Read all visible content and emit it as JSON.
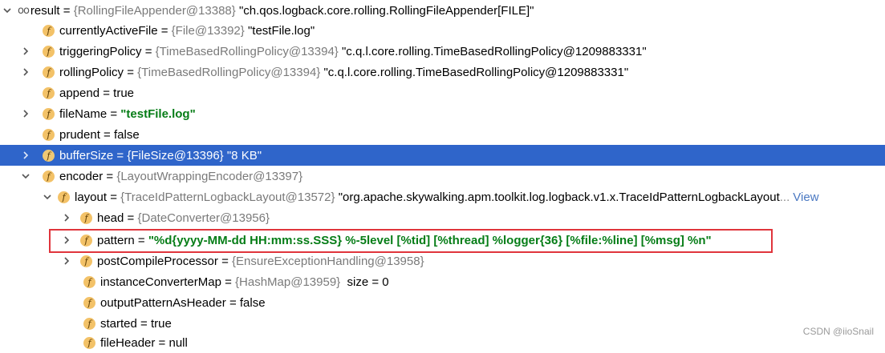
{
  "rows": [
    {
      "expander": "open",
      "name": "result",
      "ref": "{RollingFileAppender@13388}",
      "value": "\"ch.qos.logback.core.rolling.RollingFileAppender[FILE]\""
    },
    {
      "name": "currentlyActiveFile",
      "ref": "{File@13392}",
      "value": "\"testFile.log\""
    },
    {
      "expander": "closed",
      "name": "triggeringPolicy",
      "ref": "{TimeBasedRollingPolicy@13394}",
      "value": "\"c.q.l.core.rolling.TimeBasedRollingPolicy@1209883331\""
    },
    {
      "expander": "closed",
      "name": "rollingPolicy",
      "ref": "{TimeBasedRollingPolicy@13394}",
      "value": "\"c.q.l.core.rolling.TimeBasedRollingPolicy@1209883331\""
    },
    {
      "name": "append",
      "value": "true"
    },
    {
      "expander": "closed",
      "name": "fileName",
      "value": "\"testFile.log\""
    },
    {
      "name": "prudent",
      "value": "false"
    },
    {
      "expander": "closed",
      "name": "bufferSize",
      "ref": "{FileSize@13396}",
      "value": "\"8 KB\"",
      "selected": true
    },
    {
      "expander": "open",
      "name": "encoder",
      "ref": "{LayoutWrappingEncoder@13397}"
    },
    {
      "expander": "open",
      "name": "layout",
      "ref": "{TraceIdPatternLogbackLayout@13572}",
      "value": "\"org.apache.skywalking.apm.toolkit.log.logback.v1.x.TraceIdPatternLogbackLayout",
      "ellipsis": "...",
      "link": "View"
    },
    {
      "expander": "closed",
      "name": "head",
      "ref": "{DateConverter@13956}"
    },
    {
      "expander": "closed",
      "name": "pattern",
      "value": "\"%d{yyyy-MM-dd HH:mm:ss.SSS} %-5level [%tid] [%thread] %logger{36} [%file:%line] [%msg] %n\""
    },
    {
      "expander": "closed",
      "name": "postCompileProcessor",
      "ref": "{EnsureExceptionHandling@13958}"
    },
    {
      "name": "instanceConverterMap",
      "ref": "{HashMap@13959}",
      "extra": "size = 0"
    },
    {
      "name": "outputPatternAsHeader",
      "value": "false"
    },
    {
      "name": "started",
      "value": "true"
    },
    {
      "name": "fileHeader",
      "value": "null"
    }
  ],
  "equals": " = ",
  "badge_letter": "f",
  "watermark": "CSDN @iioSnail",
  "colors": {
    "selection": "#2f65ca",
    "string_value": "#067d17",
    "badge": "#f3c268",
    "highlight_border": "#e0353c"
  }
}
